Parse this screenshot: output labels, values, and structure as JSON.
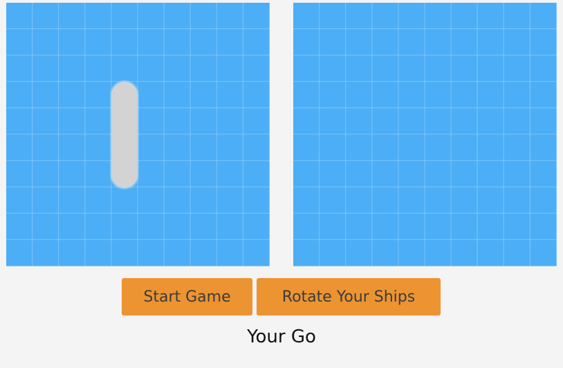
{
  "boards": {
    "player": {
      "grid_size": 10,
      "ship": {
        "orientation": "vertical",
        "length": 4
      }
    },
    "computer": {
      "grid_size": 10
    }
  },
  "controls": {
    "start_label": "Start Game",
    "rotate_label": "Rotate Your Ships"
  },
  "status": {
    "turn_text": "Your Go"
  },
  "colors": {
    "board": "#4caef6",
    "ship": "#d3d3d3",
    "button": "#ec9432",
    "background": "#f4f4f4"
  }
}
